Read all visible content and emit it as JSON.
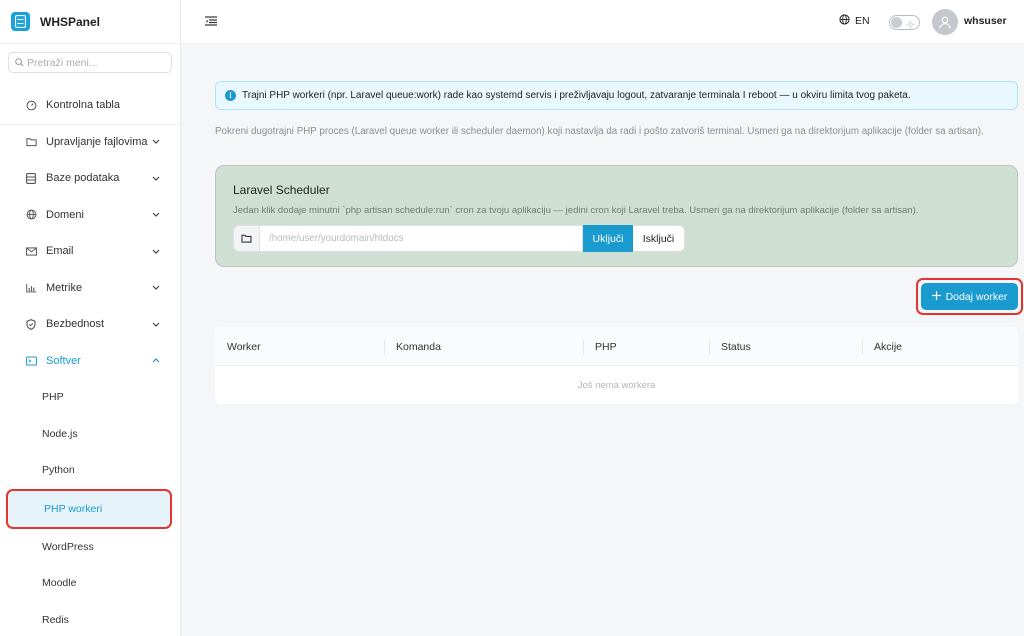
{
  "brand": {
    "name": "WHSPanel"
  },
  "search": {
    "placeholder": "Pretraži meni..."
  },
  "nav": {
    "items": [
      {
        "label": "Kontrolna tabla",
        "icon": "dashboard-icon"
      },
      {
        "label": "Upravljanje fajlovima",
        "icon": "folder-icon"
      },
      {
        "label": "Baze podataka",
        "icon": "database-icon"
      },
      {
        "label": "Domeni",
        "icon": "globe-icon"
      },
      {
        "label": "Email",
        "icon": "mail-icon"
      },
      {
        "label": "Metrike",
        "icon": "chart-icon"
      },
      {
        "label": "Bezbednost",
        "icon": "shield-icon"
      },
      {
        "label": "Softver",
        "icon": "terminal-icon"
      }
    ],
    "software_sub": [
      "PHP",
      "Node.js",
      "Python",
      "PHP workeri",
      "WordPress",
      "Moodle",
      "Redis"
    ]
  },
  "topbar": {
    "lang": "EN",
    "username": "whsuser"
  },
  "main": {
    "info": "Trajni PHP workeri (npr. Laravel queue:work) rade kao systemd servis i preživljavaju logout, zatvaranje terminala I reboot — u okviru limita tvog paketa.",
    "description": "Pokreni dugotrajni PHP proces (Laravel queue worker ili scheduler daemon) koji nastavlja da radi i pošto zatvoriš terminal. Usmeri ga na direktorijum aplikacije (folder sa artisan).",
    "scheduler": {
      "title": "Laravel Scheduler",
      "desc": "Jedan klik dodaje minutni `php artisan schedule:run` cron za tvoju aplikaciju — jedini cron koji Laravel treba. Usmeri ga na direktorijum aplikacije (folder sa artisan).",
      "path_placeholder": "/home/user/yourdomain/htdocs",
      "enable_label": "Uključi",
      "disable_label": "Isključi"
    },
    "add_worker_label": "Dodaj worker",
    "table": {
      "columns": [
        "Worker",
        "Komanda",
        "PHP",
        "Status",
        "Akcije"
      ],
      "empty": "Još nema workera"
    }
  },
  "colors": {
    "accent": "#1a9bd0",
    "highlight": "#e3342f",
    "scheduler_bg": "#cfdfd3"
  }
}
